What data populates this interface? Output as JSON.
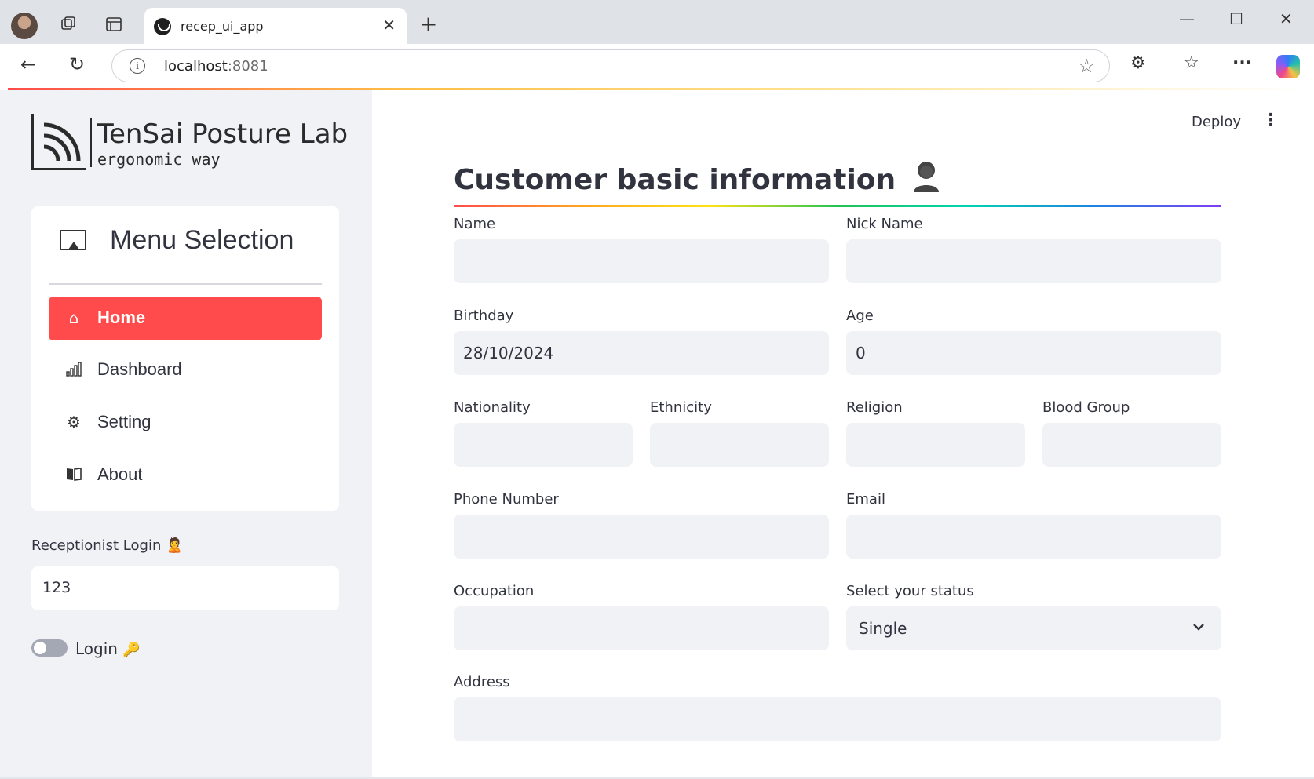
{
  "browser": {
    "tab_title": "recep_ui_app",
    "url_host": "localhost",
    "url_port": ":8081",
    "icons": [
      "profile-avatar",
      "workspaces-icon",
      "vertical-tabs-icon",
      "close-icon",
      "new-tab-icon",
      "minimize-icon",
      "maximize-icon",
      "close-window-icon",
      "back-icon",
      "refresh-icon",
      "info-icon",
      "favorite-star-icon",
      "extensions-icon",
      "favorites-icon",
      "more-icon",
      "copilot-icon"
    ]
  },
  "sidebar": {
    "brand_title": "TenSai Posture Lab",
    "brand_subtitle": "ergonomic way",
    "menu_title": "Menu Selection",
    "menu_items": [
      {
        "label": "Home",
        "icon": "house-icon",
        "active": true
      },
      {
        "label": "Dashboard",
        "icon": "bar-chart-icon",
        "active": false
      },
      {
        "label": "Setting",
        "icon": "gear-icon",
        "active": false
      },
      {
        "label": "About",
        "icon": "book-icon",
        "active": false
      }
    ],
    "login_label": "Receptionist Login",
    "login_value": "123",
    "toggle_label": "Login",
    "toggle_on": false
  },
  "header": {
    "deploy_label": "Deploy",
    "menu_icon": "kebab-menu-icon"
  },
  "form": {
    "title": "Customer basic information",
    "title_icon": "person-icon",
    "name_label": "Name",
    "name_value": "",
    "nickname_label": "Nick Name",
    "nickname_value": "",
    "birthday_label": "Birthday",
    "birthday_value": "28/10/2024",
    "age_label": "Age",
    "age_value": "0",
    "nationality_label": "Nationality",
    "ethnicity_label": "Ethnicity",
    "religion_label": "Religion",
    "blood_label": "Blood Group",
    "phone_label": "Phone Number",
    "email_label": "Email",
    "occupation_label": "Occupation",
    "status_label": "Select your status",
    "status_value": "Single",
    "address_label": "Address"
  },
  "colors": {
    "accent": "#ff4b4b",
    "sidebar_bg": "#f0f2f6",
    "input_bg": "#f0f2f6",
    "text": "#31333f"
  }
}
